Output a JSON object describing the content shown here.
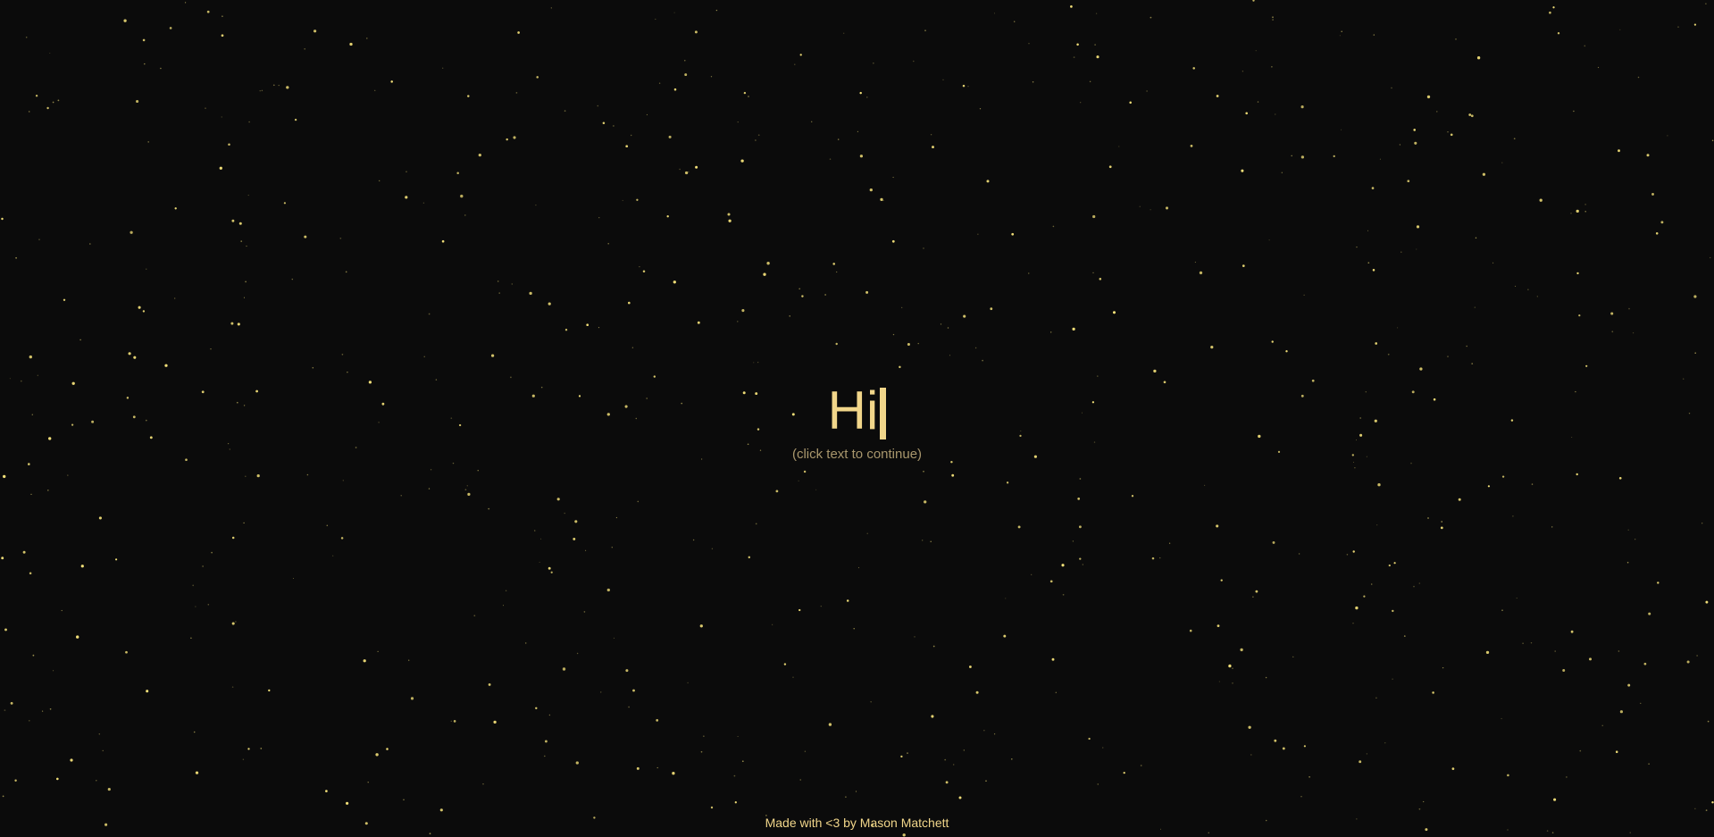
{
  "greeting": {
    "text": "Hi",
    "hint": "(click text to continue)"
  },
  "footer": {
    "credit": "Made with <3 by Mason Matchett"
  },
  "colors": {
    "background": "#0b0b0b",
    "star": "#f5e27a",
    "text": "#f1d68a",
    "hint": "#a8966c"
  }
}
